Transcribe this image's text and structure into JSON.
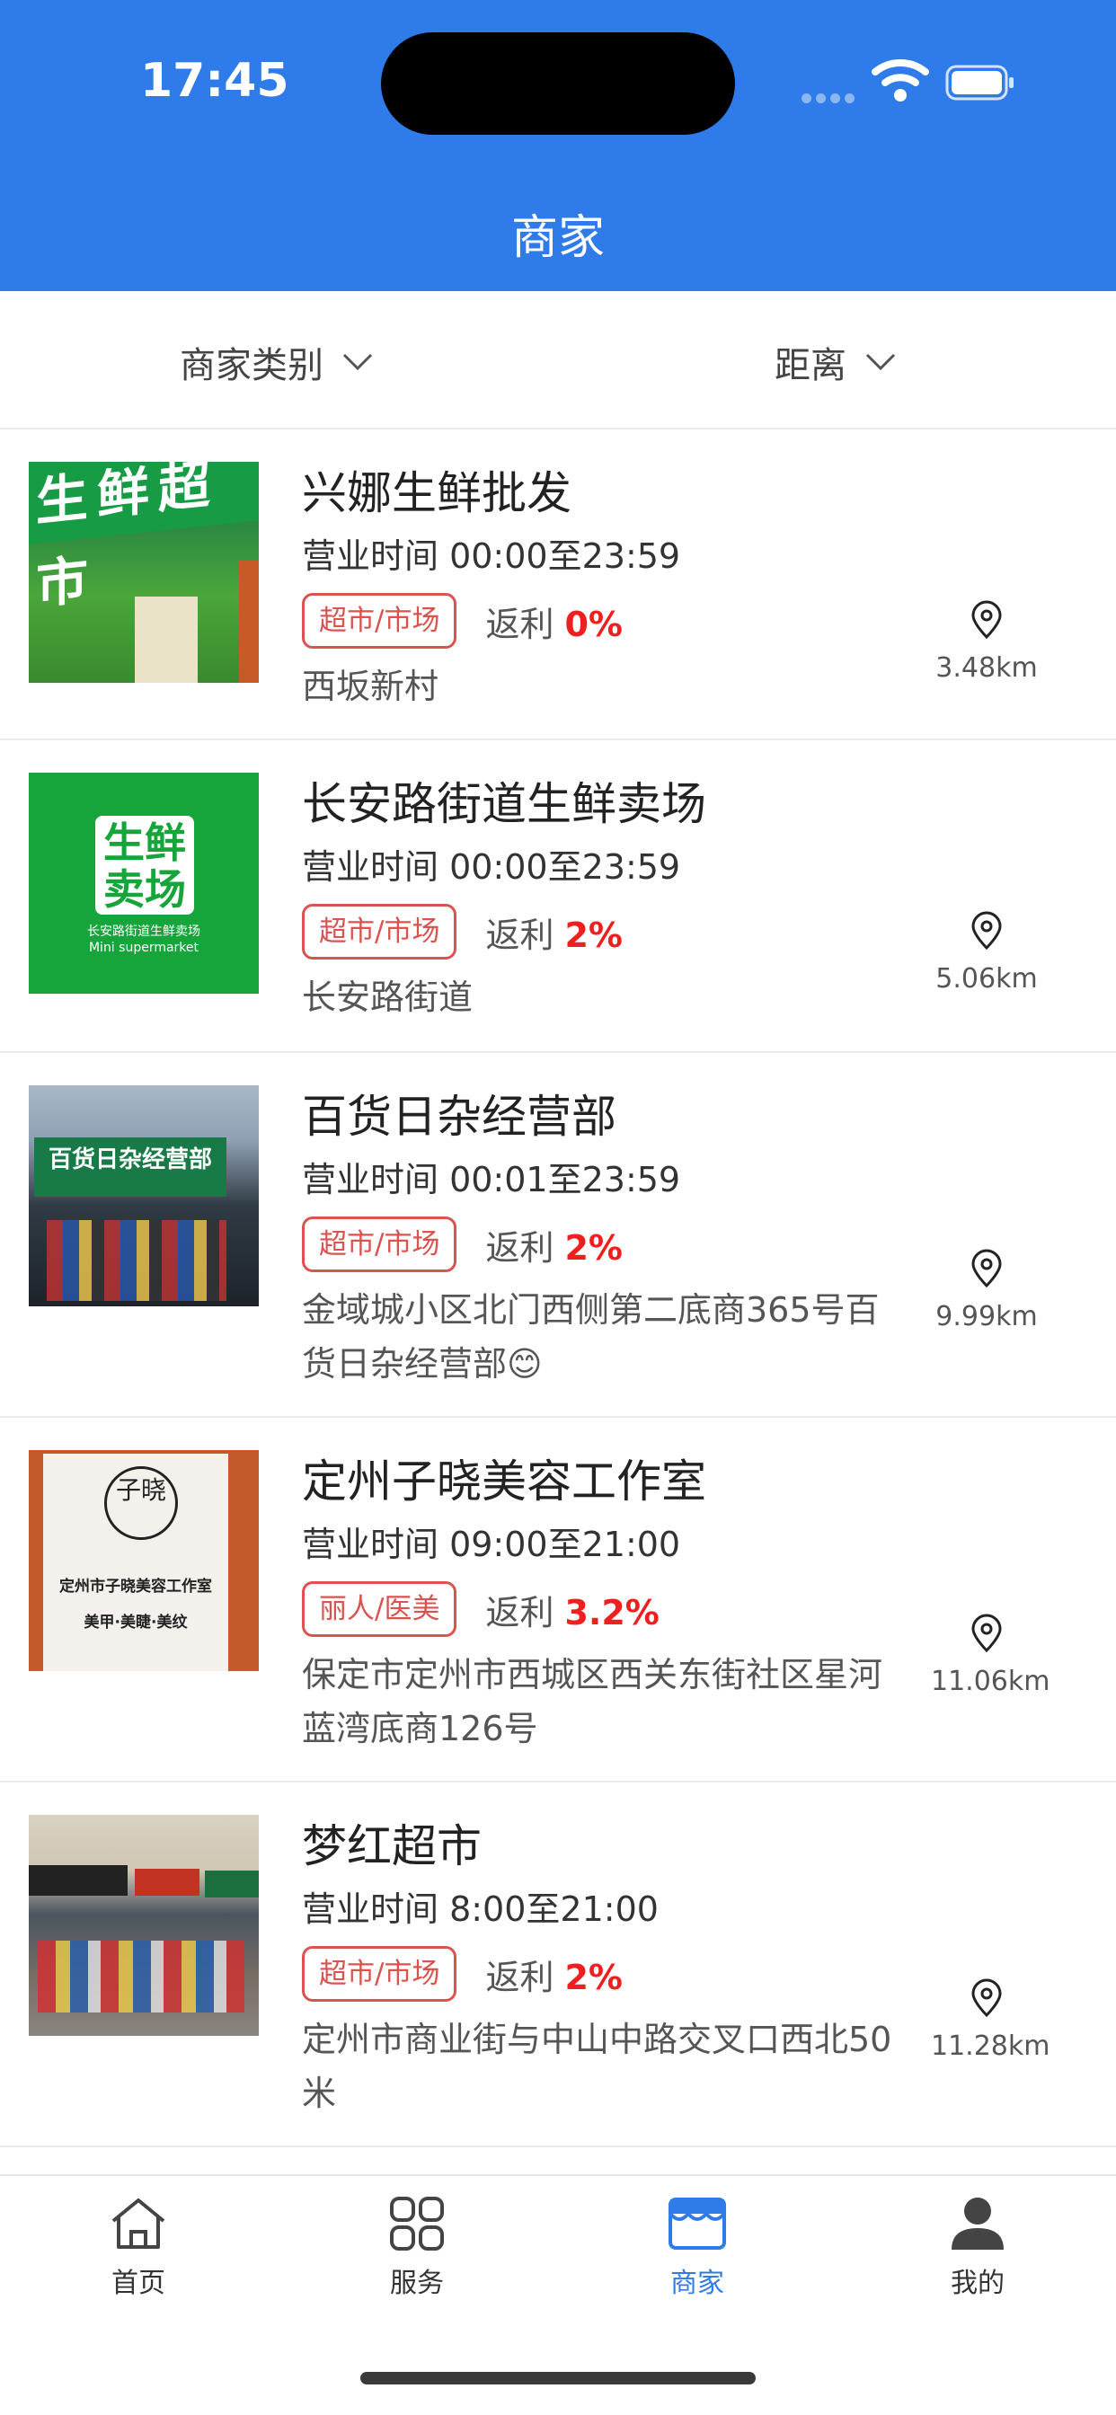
{
  "status_bar": {
    "time": "17:45"
  },
  "header": {
    "title": "商家"
  },
  "filters": {
    "category_label": "商家类别",
    "distance_label": "距离"
  },
  "merchants": [
    {
      "name": "兴娜生鲜批发",
      "hours": "营业时间 00:00至23:59",
      "tag": "超市/市场",
      "rebate_label": "返利",
      "rebate_value": "0%",
      "address": "西坂新村",
      "distance": "3.48km",
      "image_text": "生鲜超市"
    },
    {
      "name": "长安路街道生鲜卖场",
      "hours": "营业时间 00:00至23:59",
      "tag": "超市/市场",
      "rebate_label": "返利",
      "rebate_value": "2%",
      "address": "长安路街道",
      "distance": "5.06km",
      "image_text_1": "生鲜",
      "image_text_2": "卖场",
      "image_text_3": "长安路街道生鲜卖场",
      "image_text_4": "Mini supermarket"
    },
    {
      "name": "百货日杂经营部",
      "hours": "营业时间 00:01至23:59",
      "tag": "超市/市场",
      "rebate_label": "返利",
      "rebate_value": "2%",
      "address": "金域城小区北门西侧第二底商365号百货日杂经营部😊",
      "distance": "9.99km",
      "image_text": "百货日杂经营部"
    },
    {
      "name": "定州子晓美容工作室",
      "hours": "营业时间 09:00至21:00",
      "tag": "丽人/医美",
      "rebate_label": "返利",
      "rebate_value": "3.2%",
      "address": "保定市定州市西城区西关东街社区星河蓝湾底商126号",
      "distance": "11.06km",
      "image_text_1": "子晓",
      "image_text_2": "定州市子晓美容工作室",
      "image_text_3": "美甲·美睫·美纹"
    },
    {
      "name": "梦红超市",
      "hours": "营业时间 8:00至21:00",
      "tag": "超市/市场",
      "rebate_label": "返利",
      "rebate_value": "2%",
      "address": "定州市商业街与中山中路交叉口西北50米",
      "distance": "11.28km"
    }
  ],
  "tabbar": {
    "items": [
      {
        "label": "首页",
        "icon": "home-icon",
        "active": false
      },
      {
        "label": "服务",
        "icon": "grid-icon",
        "active": false
      },
      {
        "label": "商家",
        "icon": "store-icon",
        "active": true
      },
      {
        "label": "我的",
        "icon": "user-icon",
        "active": false
      }
    ]
  },
  "colors": {
    "primary": "#2f7bea",
    "tag_red": "#d9534f",
    "rebate_red": "#f01f1f"
  }
}
